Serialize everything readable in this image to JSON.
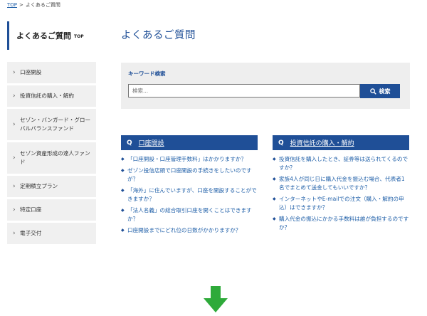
{
  "breadcrumb": {
    "top": "TOP",
    "separator": ">",
    "current": "よくあるご質問"
  },
  "sidebar": {
    "title": "よくあるご質問",
    "title_sub": "TOP",
    "items": [
      {
        "label": "口座開設",
        "chevron": "›"
      },
      {
        "label": "投資信託の購入・解約",
        "chevron": "›"
      },
      {
        "label": "セゾン・バンガード・グローバルバランスファンド",
        "chevron": "›"
      },
      {
        "label": "セゾン資産形成の達人ファンド",
        "chevron": "›"
      },
      {
        "label": "定期積立プラン",
        "chevron": "›"
      },
      {
        "label": "特定口座",
        "chevron": "›"
      },
      {
        "label": "電子交付",
        "chevron": "›"
      }
    ]
  },
  "main": {
    "title": "よくあるご質問",
    "search": {
      "label": "キーワード検索",
      "placeholder": "検索...",
      "value": "",
      "button_label": "検索",
      "icon": "search-icon"
    },
    "sections": [
      {
        "q": "Q",
        "title": "口座開設",
        "items": [
          "「口座開設・口座管理手数料」はかかりますか？",
          "ゼゾン投信店頭で口座開設の手続きをしたいのですが？",
          "「海外」に住んでいますが、口座を開設することができますか？",
          "「法人名義」の総合取引口座を開くことはできますか？",
          "口座開設までにどれ位の日数がかかりますか？"
        ]
      },
      {
        "q": "Q",
        "title": "投資信託の購入・解約",
        "items": [
          "投資信託を購入したとき、証券等は送られてくるのですか？",
          "家族4人が同じ日に購入代金を振込む場合、代表者1名でまとめて送金してもいいですか？",
          "インターネットやE-mailでの注文（購入・解約の申込）はできますか？",
          "購入代金の振込にかかる手数料は誰が負担するのですか？"
        ]
      }
    ]
  },
  "colors": {
    "brand": "#1f4f97",
    "link": "#1f5fa8",
    "panel": "#eeeeee",
    "arrow": "#2eaa3a"
  },
  "icons": {
    "bullet": "◆",
    "arrow": "down-arrow-icon"
  }
}
